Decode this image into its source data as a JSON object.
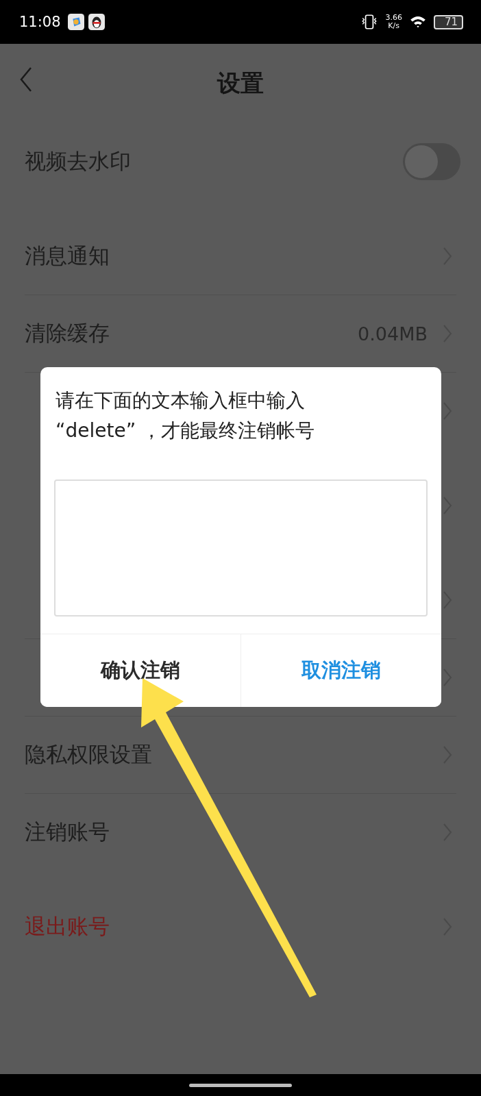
{
  "status_bar": {
    "time": "11:08",
    "speed": "3.66",
    "speed_unit": "K/s",
    "battery": "71"
  },
  "header": {
    "title": "设置"
  },
  "sections": [
    {
      "rows": [
        {
          "kind": "toggle",
          "label": "视频去水印",
          "on": false
        }
      ]
    },
    {
      "rows": [
        {
          "kind": "link",
          "label": "消息通知"
        },
        {
          "kind": "link",
          "label": "清除缓存",
          "value": "0.04MB"
        },
        {
          "kind": "link"
        }
      ]
    },
    {
      "rows": [
        {
          "kind": "link"
        }
      ]
    },
    {
      "rows": [
        {
          "kind": "link"
        },
        {
          "kind": "link"
        },
        {
          "kind": "link",
          "label": "隐私权限设置"
        },
        {
          "kind": "link",
          "label": "注销账号"
        }
      ]
    },
    {
      "rows": [
        {
          "kind": "link",
          "label": "退出账号",
          "danger": true
        }
      ]
    }
  ],
  "dialog": {
    "message_lines": [
      "请在下面的文本输入框中输入",
      "“delete” ，才能最终注销帐号"
    ],
    "buttons": [
      {
        "label": "确认注销",
        "kind": "default"
      },
      {
        "label": "取消注销",
        "kind": "primary"
      }
    ]
  }
}
